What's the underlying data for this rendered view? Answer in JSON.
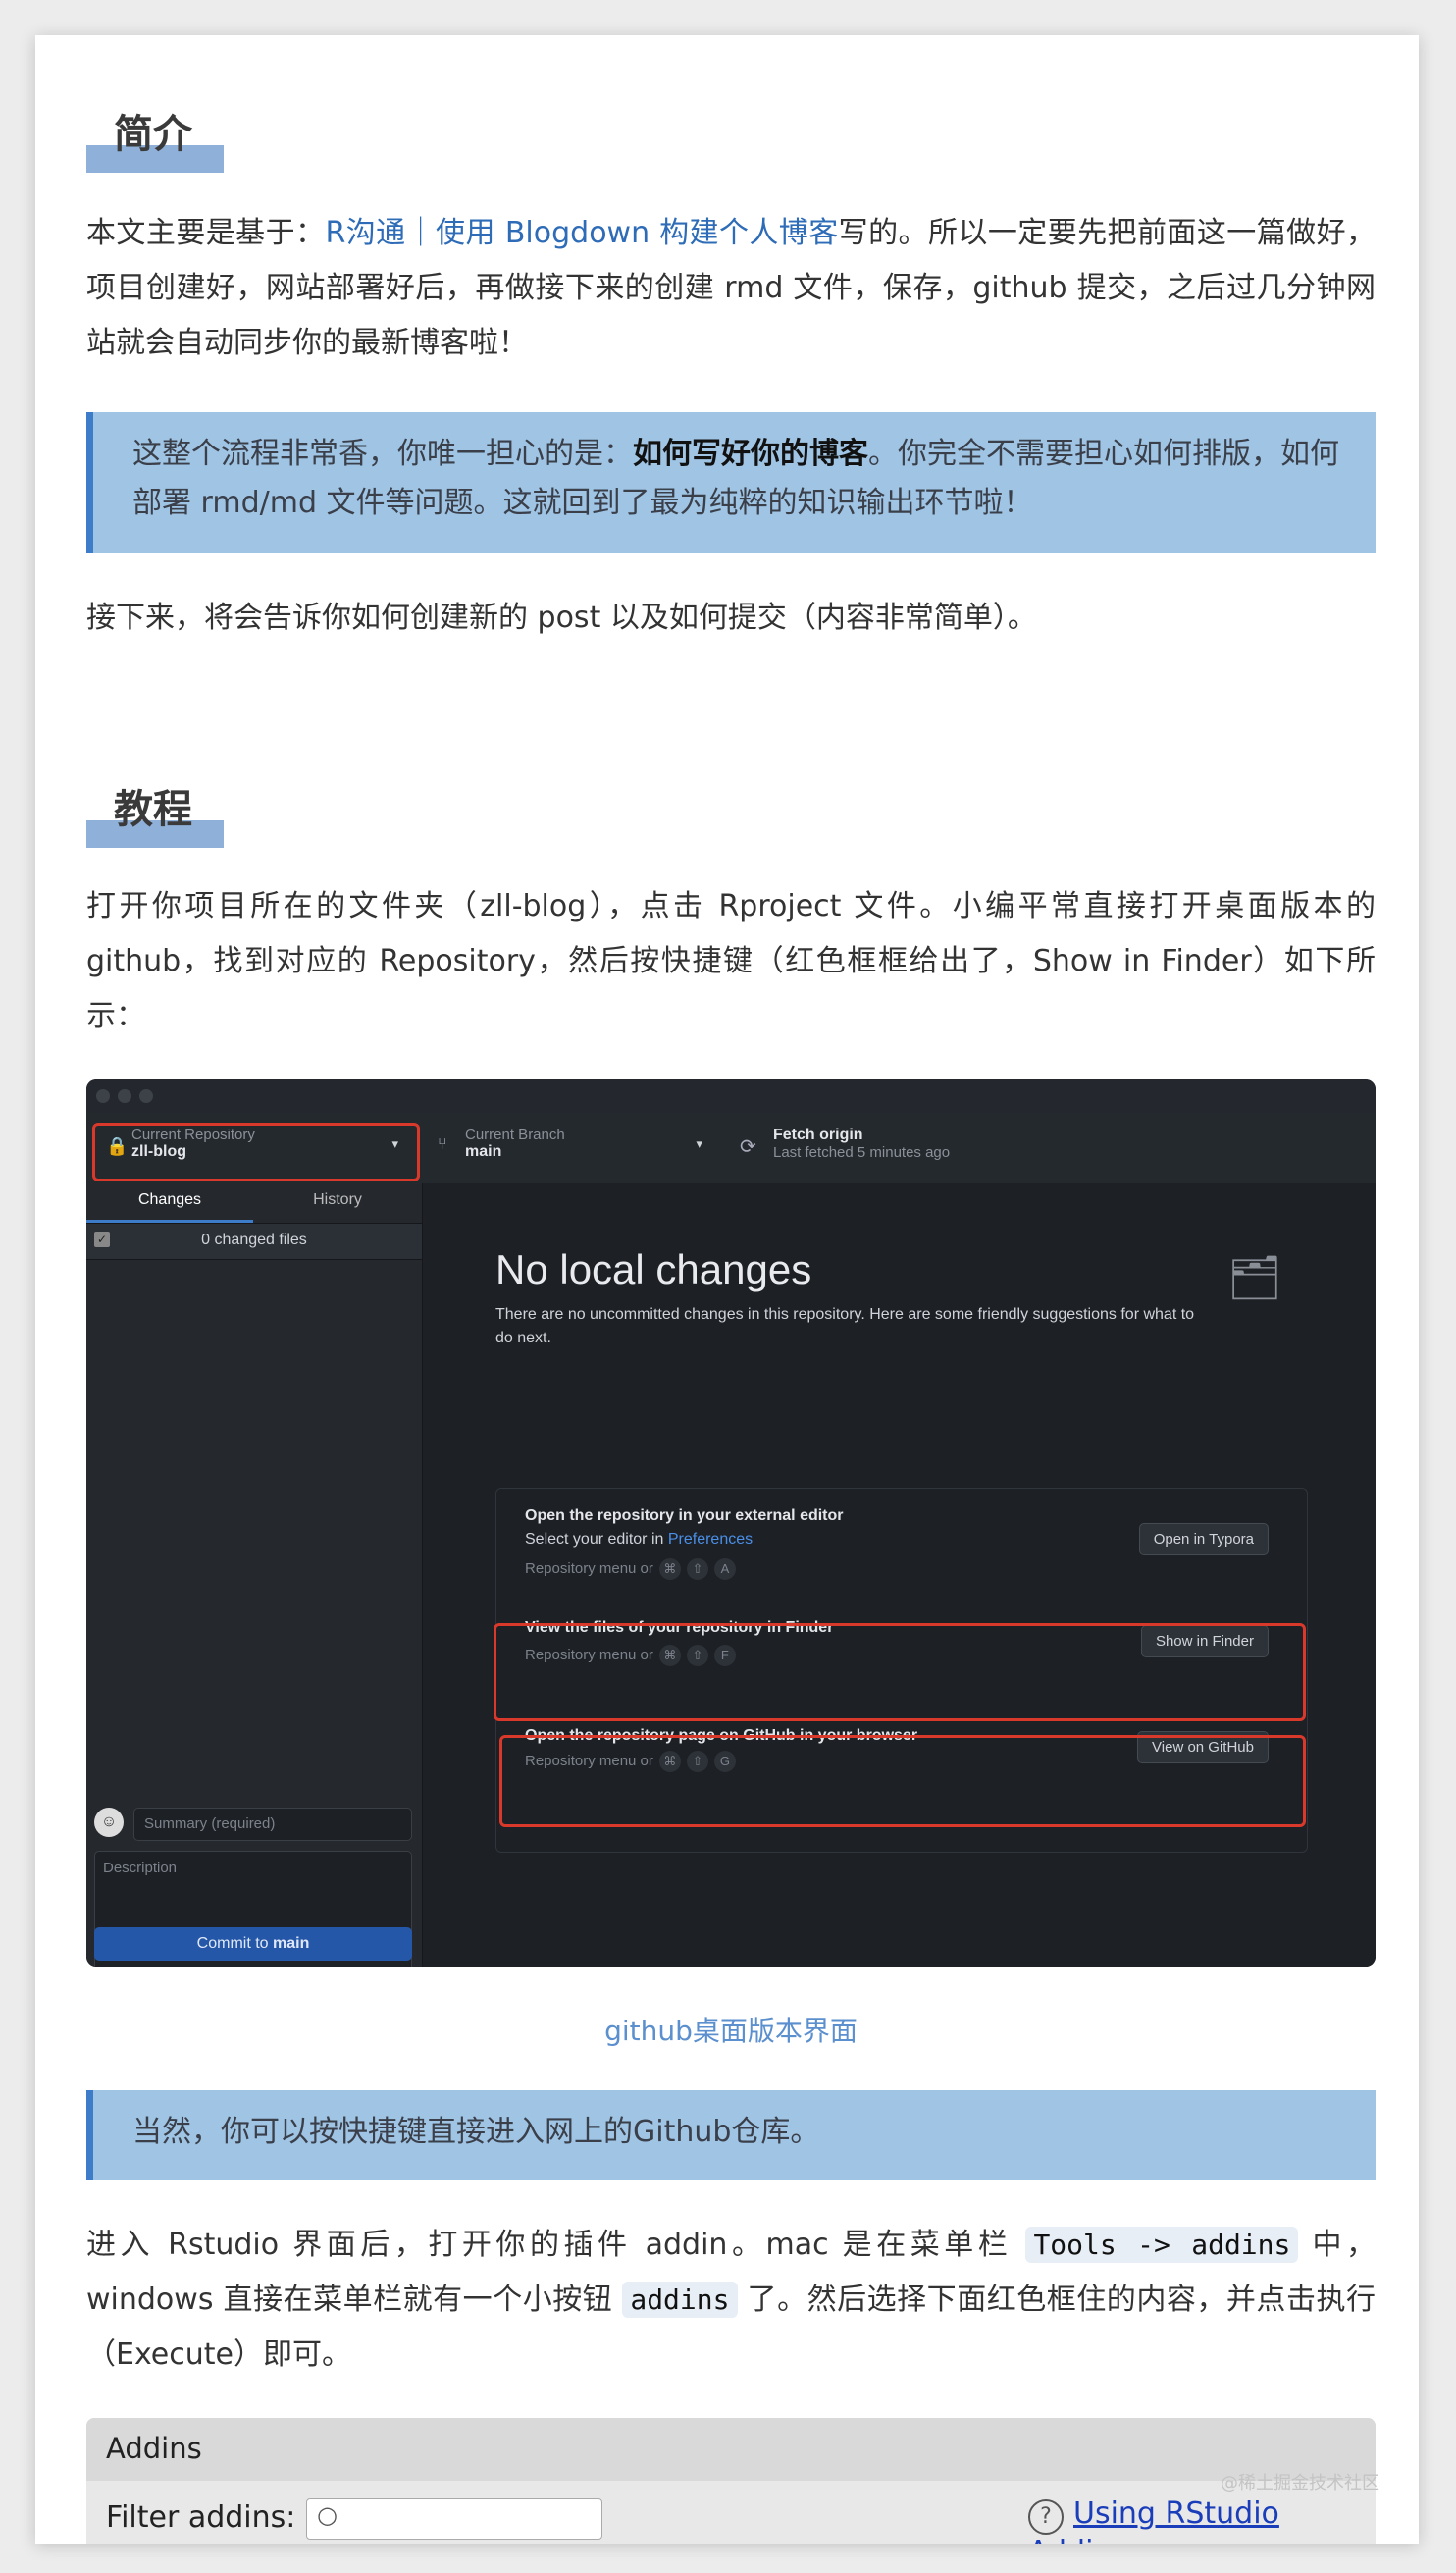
{
  "section1": {
    "heading": "简介",
    "intro_prefix": "本文主要是基于：",
    "intro_link": "R沟通｜使用 Blogdown 构建个人博客",
    "intro_suffix": "写的。所以一定要先把前面这一篇做好，项目创建好，网站部署好后，再做接下来的创建 rmd 文件，保存，github 提交，之后过几分钟网站就会自动同步你的最新博客啦！",
    "quote_prefix": "这整个流程非常香，你唯一担心的是：",
    "quote_bold": "如何写好你的博客",
    "quote_suffix": "。你完全不需要担心如何排版，如何部署 rmd/md 文件等问题。这就回到了最为纯粹的知识输出环节啦！",
    "next": "接下来，将会告诉你如何创建新的 post 以及如何提交（内容非常简单）。"
  },
  "section2": {
    "heading": "教程",
    "para": "打开你项目所在的文件夹（zll-blog），点击 Rproject 文件。小编平常直接打开桌面版本的 github，找到对应的 Repository，然后按快捷键（红色框框给出了，Show in Finder）如下所示：",
    "caption": "github桌面版本界面",
    "quote2": "当然，你可以按快捷键直接进入网上的Github仓库。",
    "rstudio_p1": "进入 Rstudio 界面后，打开你的插件 addin。mac 是在菜单栏 ",
    "rstudio_code1": "Tools -> addins",
    "rstudio_p2": " 中，windows 直接在菜单栏就有一个小按钮 ",
    "rstudio_code2": "addins",
    "rstudio_p3": " 了。然后选择下面红色框住的内容，并点击执行（Execute）即可。"
  },
  "github_desktop": {
    "current_repo_label": "Current Repository",
    "current_repo_value": "zll-blog",
    "current_branch_label": "Current Branch",
    "current_branch_value": "main",
    "fetch_label": "Fetch origin",
    "fetch_sub": "Last fetched 5 minutes ago",
    "tab_changes": "Changes",
    "tab_history": "History",
    "changed_files": "0 changed files",
    "summary_placeholder": "Summary (required)",
    "description_placeholder": "Description",
    "commit_prefix": "Commit to ",
    "commit_branch": "main",
    "no_changes_title": "No local changes",
    "no_changes_desc": "There are no uncommitted changes in this repository. Here are some friendly suggestions for what to do next.",
    "card1_title": "Open the repository in your external editor",
    "card1_sub_prefix": "Select your editor in ",
    "card1_sub_link": "Preferences",
    "card1_menu": "Repository menu or",
    "card1_key1": "⌘",
    "card1_key2": "⇧",
    "card1_key3": "A",
    "card1_button": "Open in Typora",
    "card2_title": "View the files of your repository in Finder",
    "card2_menu": "Repository menu or",
    "card2_key1": "⌘",
    "card2_key2": "⇧",
    "card2_key3": "F",
    "card2_button": "Show in Finder",
    "card3_title": "Open the repository page on GitHub in your browser",
    "card3_menu": "Repository menu or",
    "card3_key1": "⌘",
    "card3_key2": "⇧",
    "card3_key3": "G",
    "card3_button": "View on GitHub",
    "accent_color": "#d8392b"
  },
  "addins_panel": {
    "title": "Addins",
    "filter_label": "Filter addins:",
    "help_icon": "?",
    "help_link": "Using RStudio Addins"
  },
  "watermark": "@稀土掘金技术社区"
}
